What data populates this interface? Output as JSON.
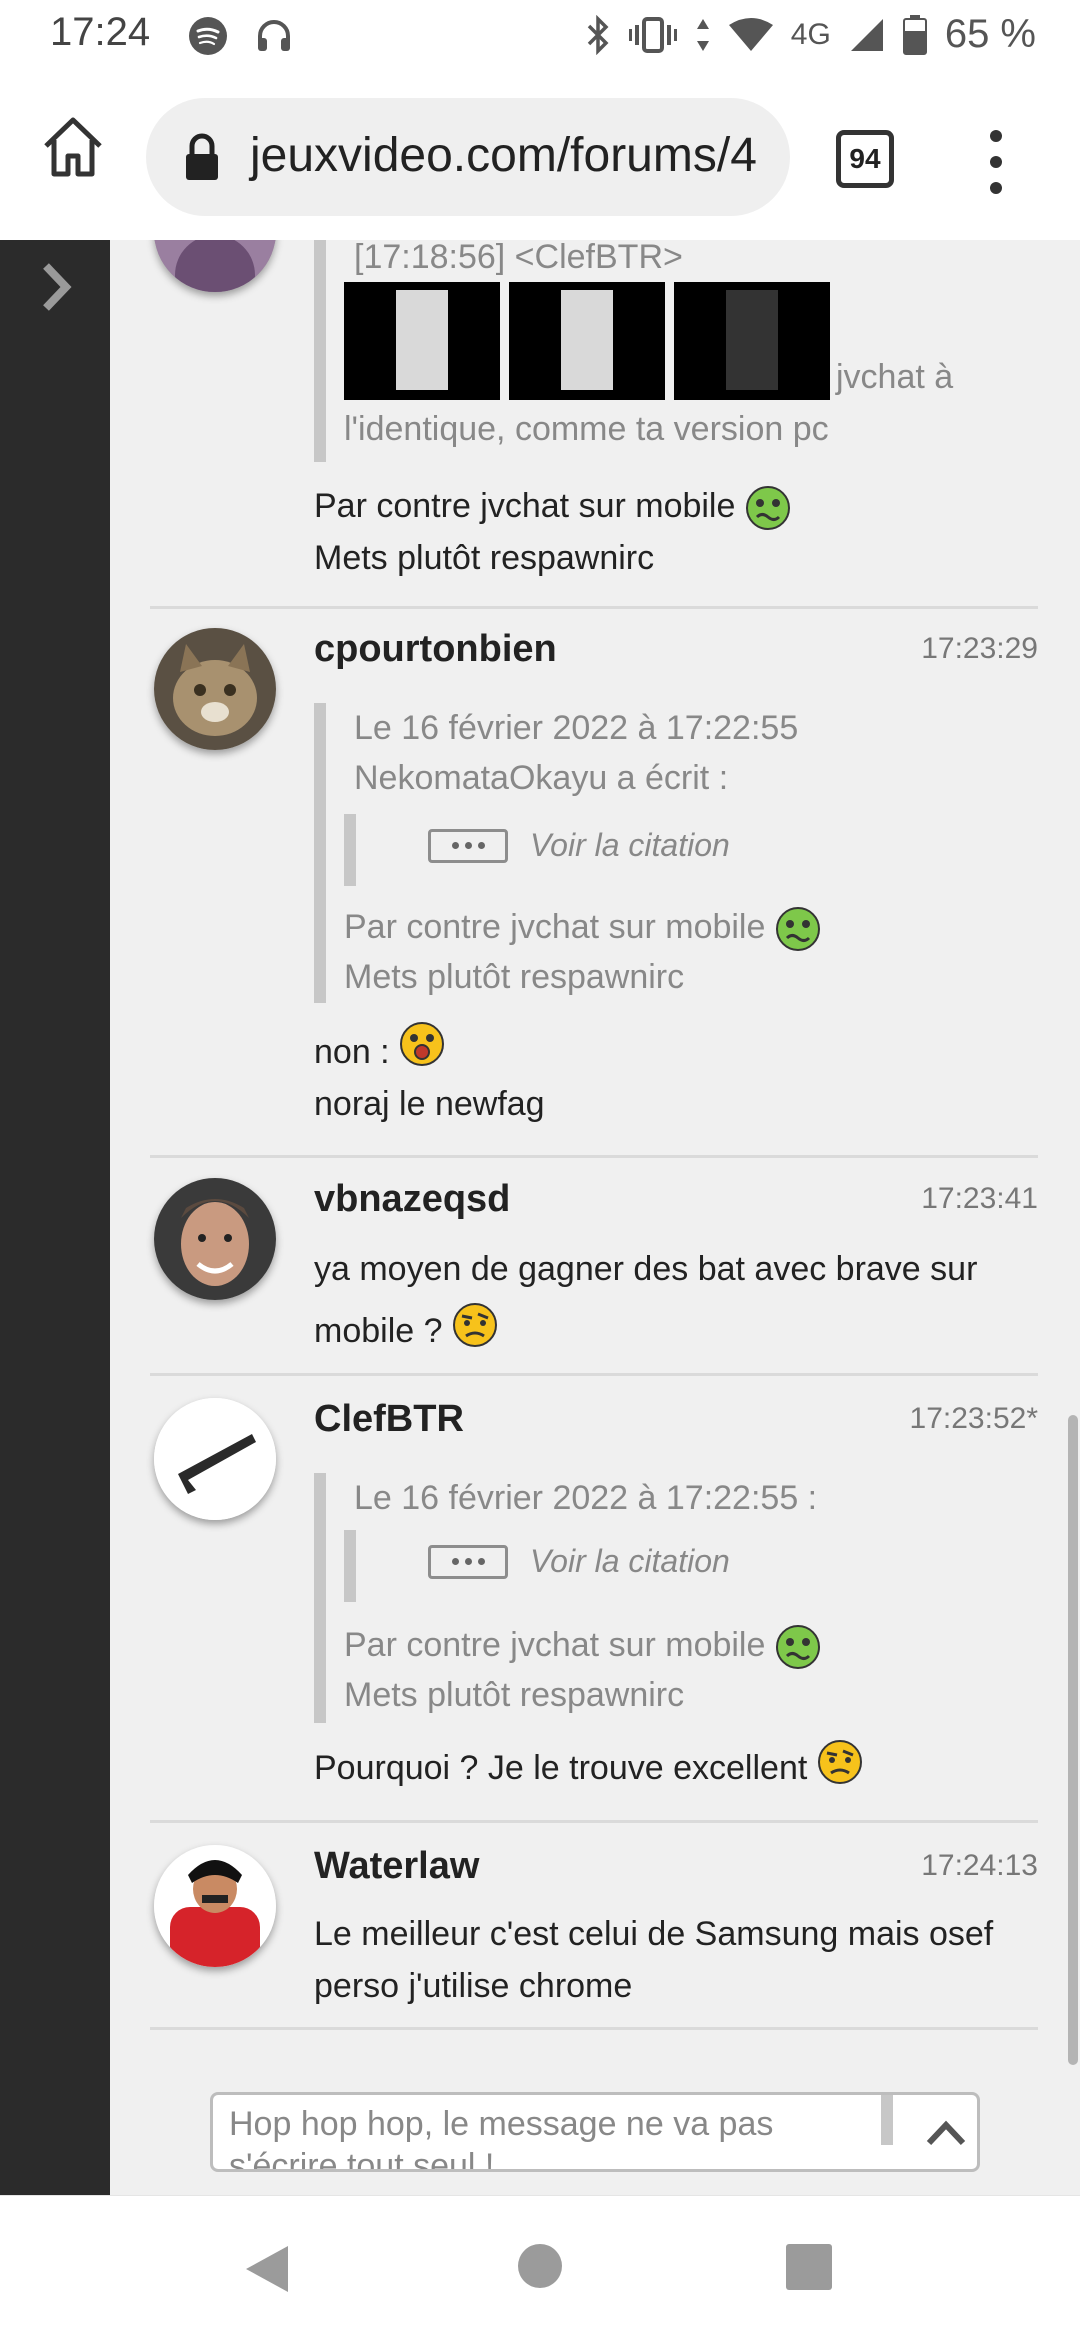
{
  "status_bar": {
    "time": "17:24",
    "network": "4G",
    "battery": "65 %",
    "icons": [
      "spotify-icon",
      "headset-icon",
      "bluetooth-icon",
      "vibrate-icon",
      "data-arrows-icon",
      "wifi-icon",
      "signal-icon",
      "battery-icon"
    ]
  },
  "browser": {
    "url": "jeuxvideo.com/forums/4",
    "tab_count": "94"
  },
  "messages": [
    {
      "partial": true,
      "quote_line": "[17:18:56] <ClefBTR>",
      "quote_trailing_1": "jvchat à",
      "quote_trailing_2": "l'identique, comme ta version pc",
      "body_line_1": "Par contre jvchat sur mobile",
      "body_line_2": "Mets plutôt respawnirc"
    },
    {
      "author": "cpourtonbien",
      "time": "17:23:29",
      "quote_header_1": "Le 16 février 2022 à 17:22:55",
      "quote_header_2": "NekomataOkayu a écrit :",
      "see_quote": "Voir la citation",
      "quote_line_1": "Par contre jvchat sur mobile",
      "quote_line_2": "Mets plutôt respawnirc",
      "body_line_1": "non :",
      "body_line_2": "noraj le newfag"
    },
    {
      "author": "vbnazeqsd",
      "time": "17:23:41",
      "body_line_1": "ya moyen de gagner des bat avec brave sur",
      "body_line_2": "mobile ?"
    },
    {
      "author": "ClefBTR",
      "time": "17:23:52*",
      "quote_header_1": "Le 16 février 2022 à 17:22:55 :",
      "see_quote": "Voir la citation",
      "quote_line_1": "Par contre jvchat sur mobile",
      "quote_line_2": "Mets plutôt respawnirc",
      "body_line_1": "Pourquoi ? Je le trouve excellent"
    },
    {
      "author": "Waterlaw",
      "time": "17:24:13",
      "body_line_1": "Le meilleur c'est celui de Samsung mais osef",
      "body_line_2": "perso j'utilise chrome"
    }
  ],
  "reply": {
    "placeholder": "Hop hop hop, le message ne va pas s'écrire tout seul !"
  },
  "colors": {
    "content_bg": "#f0f0f0",
    "left_strip": "#2b2b2b",
    "quote_bar": "#c7c7c7"
  }
}
